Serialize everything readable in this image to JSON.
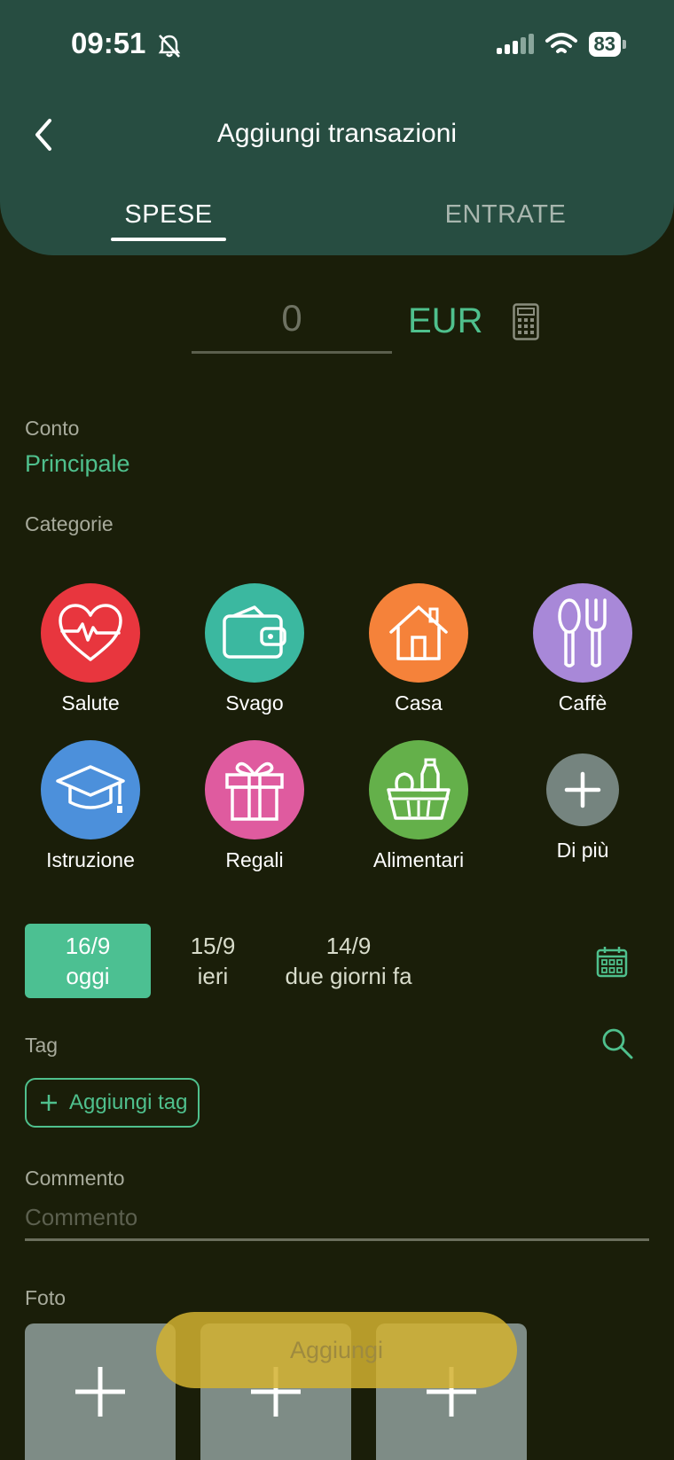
{
  "status_bar": {
    "time": "09:51",
    "battery": "83"
  },
  "header": {
    "title": "Aggiungi transazioni"
  },
  "tabs": [
    {
      "label": "SPESE",
      "active": true
    },
    {
      "label": "ENTRATE",
      "active": false
    }
  ],
  "amount": {
    "value": "0",
    "currency": "EUR"
  },
  "account": {
    "label": "Conto",
    "value": "Principale"
  },
  "categories": {
    "label": "Categorie",
    "items": [
      {
        "label": "Salute",
        "icon": "heart-pulse-icon",
        "color": "#e8363e"
      },
      {
        "label": "Svago",
        "icon": "wallet-icon",
        "color": "#3bb8a0"
      },
      {
        "label": "Casa",
        "icon": "house-icon",
        "color": "#f5823a"
      },
      {
        "label": "Caffè",
        "icon": "spoon-fork-icon",
        "color": "#a888d8"
      },
      {
        "label": "Istruzione",
        "icon": "graduation-cap-icon",
        "color": "#4c90db"
      },
      {
        "label": "Regali",
        "icon": "gift-icon",
        "color": "#df5b9f"
      },
      {
        "label": "Alimentari",
        "icon": "grocery-basket-icon",
        "color": "#64b04a"
      },
      {
        "label": "Di più",
        "icon": "plus-icon",
        "color": "#75847f"
      }
    ]
  },
  "dates": [
    {
      "date": "16/9",
      "label": "oggi",
      "active": true
    },
    {
      "date": "15/9",
      "label": "ieri",
      "active": false
    },
    {
      "date": "14/9",
      "label": "due giorni fa",
      "active": false
    }
  ],
  "tags": {
    "label": "Tag",
    "add_label": "Aggiungi tag"
  },
  "comment": {
    "label": "Commento",
    "placeholder": "Commento"
  },
  "photos": {
    "label": "Foto"
  },
  "submit": {
    "label": "Aggiungi"
  },
  "colors": {
    "accent": "#4fc08d",
    "header": "#274d41",
    "background": "#1a1e09",
    "submit": "#d2b230"
  }
}
